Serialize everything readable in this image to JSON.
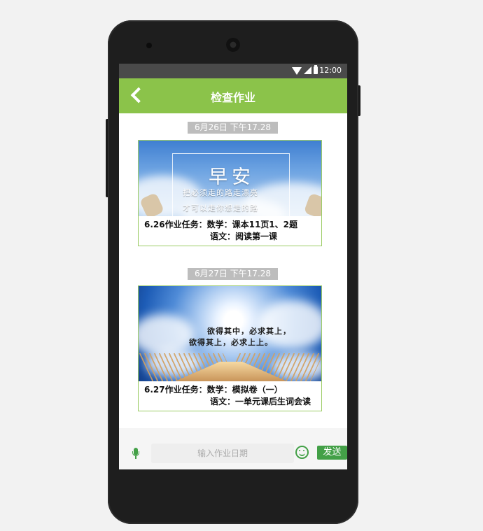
{
  "status_bar": {
    "time": "12:00"
  },
  "app_bar": {
    "title": "检查作业"
  },
  "messages": [
    {
      "date": "6月26日 下午17.28",
      "image": {
        "heading": "早安",
        "lines": [
          "把必须走的路走漂亮",
          "才可以走你想走的路"
        ]
      },
      "task_line1": "6.26作业任务：数学：课本11页1、2题",
      "task_line2": "语文：阅读第一课"
    },
    {
      "date": "6月27日 下午17.28",
      "image": {
        "lines": [
          "欲得其中，必求其上，",
          "欲得其上，必求上上。"
        ]
      },
      "task_line1": "6.27作业任务：数学：模拟卷（一）",
      "task_line2": "语文：一单元课后生词会读"
    }
  ],
  "input_bar": {
    "placeholder": "输入作业日期",
    "send_label": "发送"
  },
  "colors": {
    "app_bar": "#8bc34a",
    "accent_green": "#43a047",
    "status_bar": "#4a4a4a"
  },
  "icons": [
    "wifi-icon",
    "signal-icon",
    "battery-icon",
    "back-icon",
    "mic-icon",
    "smile-icon"
  ]
}
